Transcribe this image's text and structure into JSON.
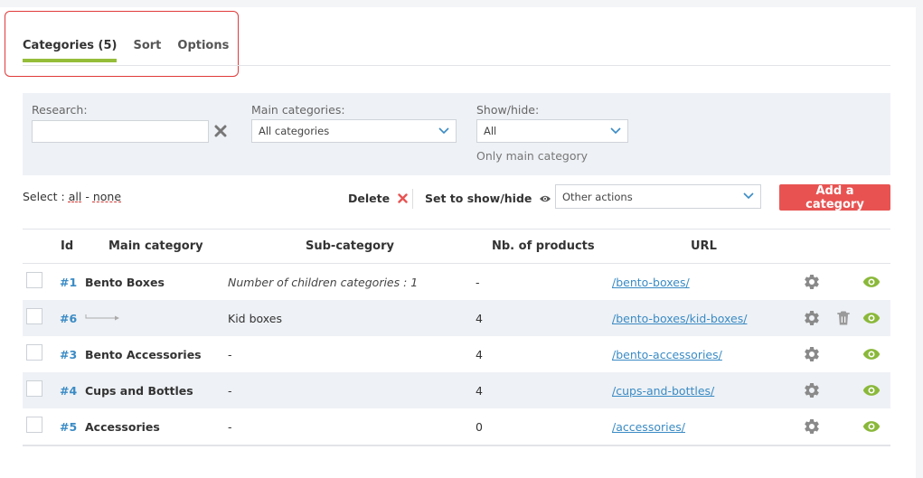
{
  "tabs": [
    {
      "label": "Categories (5)",
      "active": true
    },
    {
      "label": "Sort",
      "active": false
    },
    {
      "label": "Options",
      "active": false
    }
  ],
  "filters": {
    "research_label": "Research:",
    "research_value": "",
    "main_label": "Main categories:",
    "main_value": "All categories",
    "show_label": "Show/hide:",
    "show_value": "All",
    "only_main": "Only main category"
  },
  "toolbar": {
    "select_prefix": "Select :",
    "all": "all",
    "dash": "-",
    "none": "none",
    "delete": "Delete",
    "set_show_hide": "Set to show/hide",
    "other_actions": "Other actions",
    "add_category": "Add a category"
  },
  "table": {
    "headers": {
      "id": "Id",
      "main": "Main category",
      "sub": "Sub-category",
      "nb": "Nb. of products",
      "url": "URL"
    },
    "rows": [
      {
        "id": "#1",
        "main": "Bento Boxes",
        "sub": "Number of children categories : 1",
        "nb": "-",
        "url": "/bento-boxes/",
        "child": false,
        "deletable": false,
        "visible": true
      },
      {
        "id": "#6",
        "main": "",
        "sub": "Kid boxes",
        "nb": "4",
        "url": "/bento-boxes/kid-boxes/",
        "child": true,
        "deletable": true,
        "visible": true
      },
      {
        "id": "#3",
        "main": "Bento Accessories",
        "sub": "-",
        "nb": "4",
        "url": "/bento-accessories/",
        "child": false,
        "deletable": false,
        "visible": true
      },
      {
        "id": "#4",
        "main": "Cups and Bottles",
        "sub": "-",
        "nb": "4",
        "url": "/cups-and-bottles/",
        "child": false,
        "deletable": false,
        "visible": true
      },
      {
        "id": "#5",
        "main": "Accessories",
        "sub": "-",
        "nb": "0",
        "url": "/accessories/",
        "child": false,
        "deletable": false,
        "visible": true
      }
    ]
  },
  "colors": {
    "accent_green": "#95bd3a",
    "link_blue": "#3a8bc5",
    "danger_red": "#e85352",
    "annotation_red": "#e03a3a",
    "eye_green": "#8ab83a"
  }
}
